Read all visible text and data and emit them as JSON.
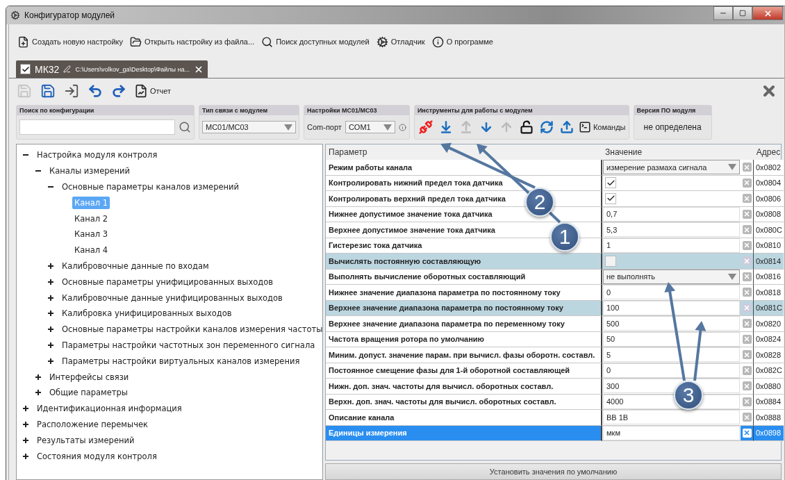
{
  "window": {
    "title": "Конфигуратор модулей"
  },
  "menu": [
    {
      "kind": "new",
      "label": "Создать новую настройку"
    },
    {
      "kind": "open",
      "label": "Открыть настройку из файла..."
    },
    {
      "kind": "search",
      "label": "Поиск доступных модулей"
    },
    {
      "kind": "debug",
      "label": "Отладчик"
    },
    {
      "kind": "about",
      "label": "О программе"
    }
  ],
  "document_tab": {
    "label": "МК32",
    "path": "C:\\Users\\volkov_ga\\Desktop\\Файлы на...",
    "checked": true,
    "selected": true
  },
  "toolbar": {
    "buttons": [
      {
        "kind": "save",
        "disabled": true
      },
      {
        "kind": "save-as",
        "disabled": false
      },
      {
        "kind": "export",
        "disabled": false
      },
      {
        "kind": "undo",
        "disabled": false
      },
      {
        "kind": "redo",
        "disabled": false
      }
    ],
    "report_label": "Отчет"
  },
  "groups": {
    "search": {
      "title": "Поиск по конфигурации"
    },
    "connection": {
      "title": "Тип связи с модулем",
      "value": "МС01/МС03"
    },
    "settings": {
      "title": "Настройки МС01/МС03",
      "port_label": "Com-порт",
      "port_value": "COM1"
    },
    "tools": {
      "title": "Инструменты для работы с модулем",
      "buttons": [
        {
          "kind": "disconnect",
          "disabled": false
        },
        {
          "kind": "read-all",
          "disabled": false
        },
        {
          "kind": "write-all",
          "disabled": true
        },
        {
          "kind": "read",
          "disabled": false
        },
        {
          "kind": "write",
          "disabled": true
        },
        {
          "kind": "unlock",
          "disabled": false
        },
        {
          "kind": "refresh",
          "disabled": false
        },
        {
          "kind": "upload",
          "disabled": false
        }
      ],
      "commands_label": "Команды"
    },
    "version": {
      "title": "Версия ПО модуля",
      "value": "не определена"
    }
  },
  "tree": [
    {
      "label": "Настройка модуля контроля",
      "expanded": true,
      "selected": false,
      "children": [
        {
          "label": "Каналы измерений",
          "expanded": true,
          "selected": false,
          "children": [
            {
              "label": "Основные параметры каналов измерений",
              "expanded": true,
              "selected": false,
              "children": [
                {
                  "label": "Канал 1",
                  "selected": true
                },
                {
                  "label": "Канал 2",
                  "selected": false
                },
                {
                  "label": "Канал 3",
                  "selected": false
                },
                {
                  "label": "Канал 4",
                  "selected": false
                }
              ]
            },
            {
              "label": "Калибровочные данные по входам",
              "expanded": false,
              "selected": false
            },
            {
              "label": "Основные параметры унифицированных выходов",
              "expanded": false,
              "selected": false
            },
            {
              "label": "Калибровочные данные унифицированных выходов",
              "expanded": false,
              "selected": false
            },
            {
              "label": "Калибровка унифицированных выходов",
              "expanded": false,
              "selected": false
            },
            {
              "label": "Основные параметры настройки каналов измерения частоты",
              "expanded": false,
              "selected": false
            },
            {
              "label": "Параметры настройки частотных зон переменного сигнала",
              "expanded": false,
              "selected": false
            },
            {
              "label": "Параметры настройки виртуальных каналов измерения",
              "expanded": false,
              "selected": false
            }
          ]
        },
        {
          "label": "Интерфейсы связи",
          "expanded": false,
          "selected": false
        },
        {
          "label": "Общие параметры",
          "expanded": false,
          "selected": false
        }
      ]
    },
    {
      "label": "Идентификационная информация",
      "expanded": false,
      "selected": false
    },
    {
      "label": "Расположение перемычек",
      "expanded": false,
      "selected": false
    },
    {
      "label": "Результаты измерений",
      "expanded": false,
      "selected": false
    },
    {
      "label": "Состояния модуля контроля",
      "expanded": false,
      "selected": false
    }
  ],
  "table": {
    "columns": [
      "Параметр",
      "Значение",
      "Адрес"
    ],
    "rows": [
      {
        "name": "Режим работы канала",
        "kind": "select",
        "value": "измерение размаха сигнала",
        "address": "0x0802",
        "highlighted": false,
        "selected": false
      },
      {
        "name": "Контролировать нижний предел тока датчика",
        "kind": "checkbox",
        "checked": true,
        "address": "0x0804",
        "highlighted": false,
        "selected": false
      },
      {
        "name": "Контролировать верхний предел тока датчика",
        "kind": "checkbox",
        "checked": true,
        "address": "0x0806",
        "highlighted": false,
        "selected": false
      },
      {
        "name": "Нижнее допустимое значение тока датчика",
        "kind": "text",
        "value": "0,7",
        "address": "0x0808",
        "highlighted": false,
        "selected": false
      },
      {
        "name": "Верхнее допустимое значение тока датчика",
        "kind": "text",
        "value": "5,3",
        "address": "0x080C",
        "highlighted": false,
        "selected": false
      },
      {
        "name": "Гистерезис тока датчика",
        "kind": "text",
        "value": "1",
        "address": "0x0810",
        "highlighted": false,
        "selected": false
      },
      {
        "name": "Вычислять постоянную составляющую",
        "kind": "checkbox",
        "checked": false,
        "address": "0x0814",
        "highlighted": true,
        "selected": false
      },
      {
        "name": "Выполнять вычисление оборотных составляющий",
        "kind": "select",
        "value": "не выполнять",
        "address": "0x0816",
        "highlighted": false,
        "selected": false
      },
      {
        "name": "Нижнее значение диапазона параметра по постоянному току",
        "kind": "text",
        "value": "0",
        "address": "0x0818",
        "highlighted": false,
        "selected": false
      },
      {
        "name": "Верхнее значение диапазона параметра по постоянному току",
        "kind": "text",
        "value": "100",
        "address": "0x081C",
        "highlighted": true,
        "selected": false
      },
      {
        "name": "Верхнее значение диапазона параметра по переменному току",
        "kind": "text",
        "value": "500",
        "address": "0x0820",
        "highlighted": false,
        "selected": false
      },
      {
        "name": "Частота вращения ротора по умолчанию",
        "kind": "text",
        "value": "50",
        "address": "0x0824",
        "highlighted": false,
        "selected": false
      },
      {
        "name": "Миним. допуст. значение парам. при вычисл. фазы оборотн. составл.",
        "kind": "text",
        "value": "5",
        "address": "0x0828",
        "highlighted": false,
        "selected": false
      },
      {
        "name": "Постоянное смещение фазы для 1-й оборотной составляющей",
        "kind": "text",
        "value": "0",
        "address": "0x082C",
        "highlighted": false,
        "selected": false
      },
      {
        "name": "Нижн. доп. знач. частоты для вычисл. оборотных составл.",
        "kind": "text",
        "value": "300",
        "address": "0x0880",
        "highlighted": false,
        "selected": false
      },
      {
        "name": "Верхн. доп. знач. частоты для вычисл. оборотных составл.",
        "kind": "text",
        "value": "4000",
        "address": "0x0884",
        "highlighted": false,
        "selected": false
      },
      {
        "name": "Описание канала",
        "kind": "text",
        "value": "ВВ 1В",
        "address": "0x0888",
        "highlighted": false,
        "selected": false
      },
      {
        "name": "Единицы измерения",
        "kind": "text",
        "value": "мкм",
        "address": "0x0898",
        "highlighted": false,
        "selected": true
      }
    ]
  },
  "default_button": "Установить значения по умолчанию",
  "callouts": [
    {
      "label": "2"
    },
    {
      "label": "1"
    },
    {
      "label": "3"
    }
  ]
}
